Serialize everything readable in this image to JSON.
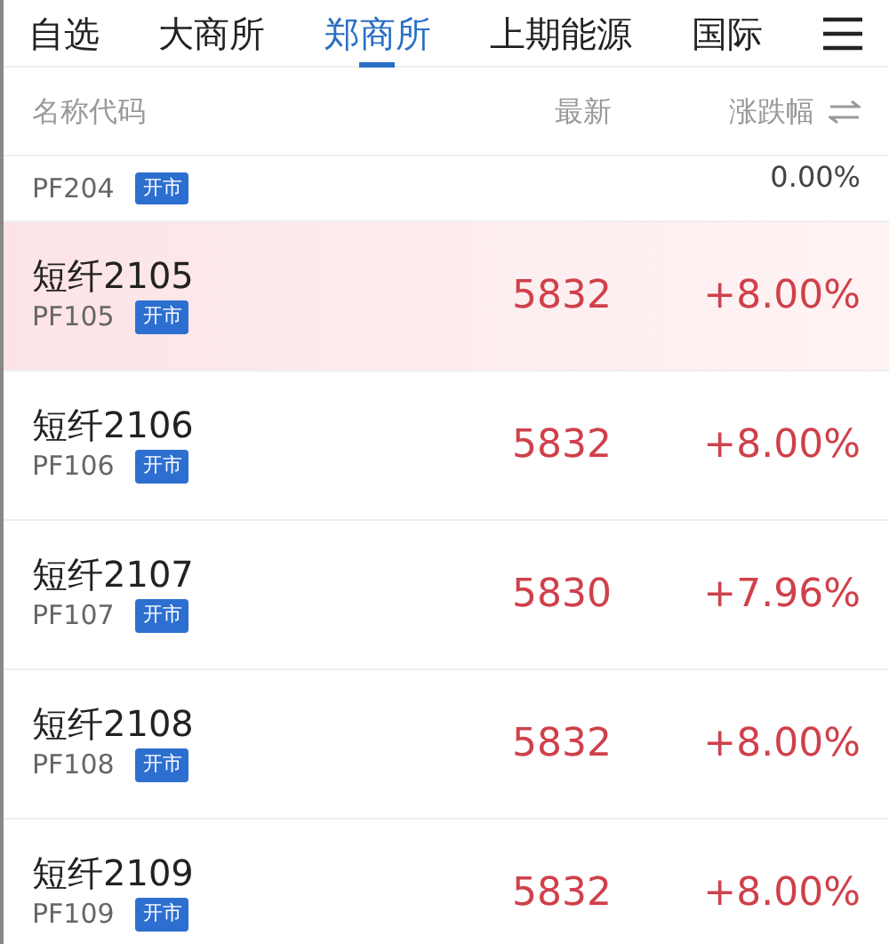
{
  "tabs": [
    {
      "label": "自选",
      "selected": false
    },
    {
      "label": "大商所",
      "selected": false
    },
    {
      "label": "郑商所",
      "selected": true
    },
    {
      "label": "上期能源",
      "selected": false
    },
    {
      "label": "国际",
      "selected": false
    }
  ],
  "header": {
    "name": "名称代码",
    "price": "最新",
    "change": "涨跌幅"
  },
  "partial_row": {
    "code": "PF204",
    "badge": "开市",
    "change": "0.00%"
  },
  "rows": [
    {
      "name": "短纤2105",
      "code": "PF105",
      "badge": "开市",
      "price": "5832",
      "change": "+8.00%",
      "highlighted": true
    },
    {
      "name": "短纤2106",
      "code": "PF106",
      "badge": "开市",
      "price": "5832",
      "change": "+8.00%",
      "highlighted": false
    },
    {
      "name": "短纤2107",
      "code": "PF107",
      "badge": "开市",
      "price": "5830",
      "change": "+7.96%",
      "highlighted": false
    },
    {
      "name": "短纤2108",
      "code": "PF108",
      "badge": "开市",
      "price": "5832",
      "change": "+8.00%",
      "highlighted": false
    },
    {
      "name": "短纤2109",
      "code": "PF109",
      "badge": "开市",
      "price": "5832",
      "change": "+8.00%",
      "highlighted": false
    }
  ]
}
